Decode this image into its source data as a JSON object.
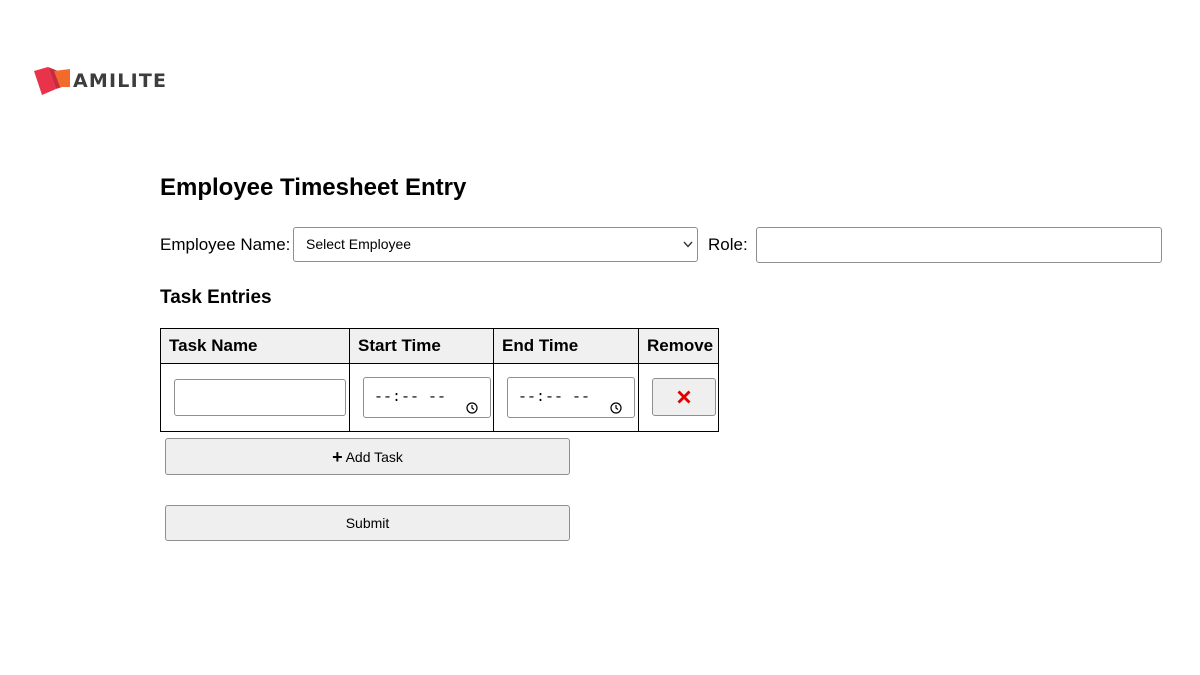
{
  "brand": {
    "logo_text": "AMILITE"
  },
  "form": {
    "title": "Employee Timesheet Entry",
    "employee_label": "Employee Name:",
    "employee_select_value": "Select Employee",
    "role_label": "Role:",
    "role_value": "",
    "role_placeholder": ""
  },
  "tasks": {
    "section_title": "Task Entries",
    "columns": [
      "Task Name",
      "Start Time",
      "End Time",
      "Remove"
    ],
    "rows": [
      {
        "task_name": "",
        "start_time_placeholder": "--:-- --",
        "end_time_placeholder": "--:-- --",
        "remove_symbol": "✕"
      }
    ],
    "add_button_icon": "+",
    "add_button_label": "Add Task"
  },
  "submit_label": "Submit",
  "colors": {
    "logo_red": "#e8334a",
    "logo_orange": "#f26b2b",
    "logo_text": "#3d3d3d",
    "remove_red": "#e00000",
    "button_bg": "#efefef",
    "header_bg": "#f0f0f0"
  },
  "icons": {
    "logo": "amilite-logo-icon",
    "select_chevron": "chevron-down-icon",
    "time": "clock-icon",
    "remove": "close-icon",
    "add": "plus-icon"
  }
}
